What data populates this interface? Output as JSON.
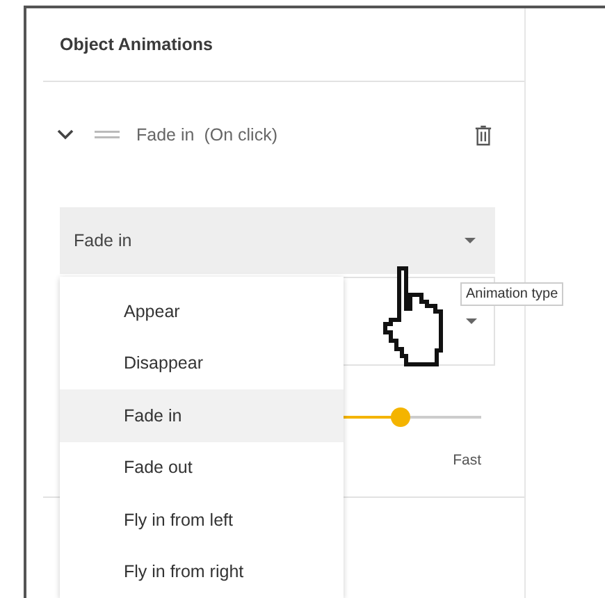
{
  "panel": {
    "title": "Object Animations"
  },
  "animation": {
    "expanded": true,
    "name": "Fade in",
    "trigger": "(On click)"
  },
  "type_select": {
    "value": "Fade in"
  },
  "type_menu": {
    "options": [
      {
        "label": "Appear",
        "selected": false
      },
      {
        "label": "Disappear",
        "selected": false
      },
      {
        "label": "Fade in",
        "selected": true
      },
      {
        "label": "Fade out",
        "selected": false
      },
      {
        "label": "Fly in from left",
        "selected": false
      },
      {
        "label": "Fly in from right",
        "selected": false
      }
    ]
  },
  "speed_slider": {
    "level": 0.81,
    "max_label": "Fast"
  },
  "tooltip": "Animation type"
}
